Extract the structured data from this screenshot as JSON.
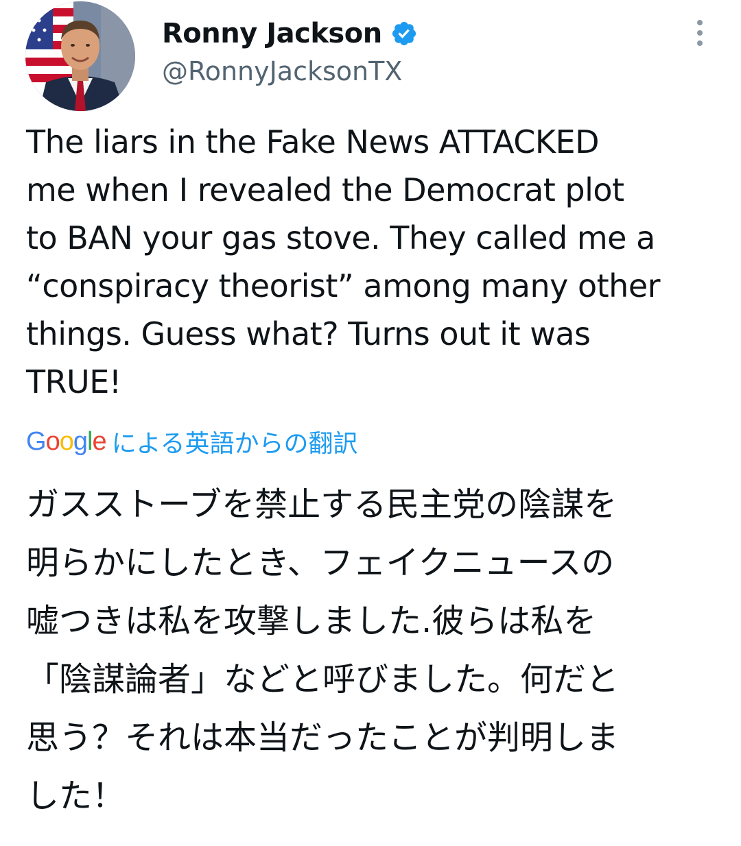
{
  "tweet": {
    "author": {
      "display_name": "Ronny Jackson",
      "handle": "@RonnyJacksonTX",
      "verified_icon": "verified-badge-icon",
      "verified_color": "#1d9bf0"
    },
    "more_icon": "more-vertical-icon",
    "text": "The liars in the Fake News ATTACKED\nme when I revealed the Democrat plot\nto BAN your gas stove. They called me a\n“conspiracy theorist” among many other\nthings. Guess what? Turns out it was\nTRUE!",
    "translation": {
      "provider_letters": [
        "G",
        "o",
        "o",
        "g",
        "l",
        "e"
      ],
      "provider_colors": [
        "#4285f4",
        "#ea4335",
        "#fbbc05",
        "#4285f4",
        "#34a853",
        "#ea4335"
      ],
      "label": "による英語からの翻訳",
      "label_color": "#1d9bf0",
      "text": "ガスストーブを禁止する民主党の陰謀を\n明らかにしたとき、フェイクニュースの\n嘘つきは私を攻撃しました.彼らは私を\n「陰謀論者」などと呼びました。何だと\n思う？それは本当だったことが判明しま\nした！"
    }
  }
}
